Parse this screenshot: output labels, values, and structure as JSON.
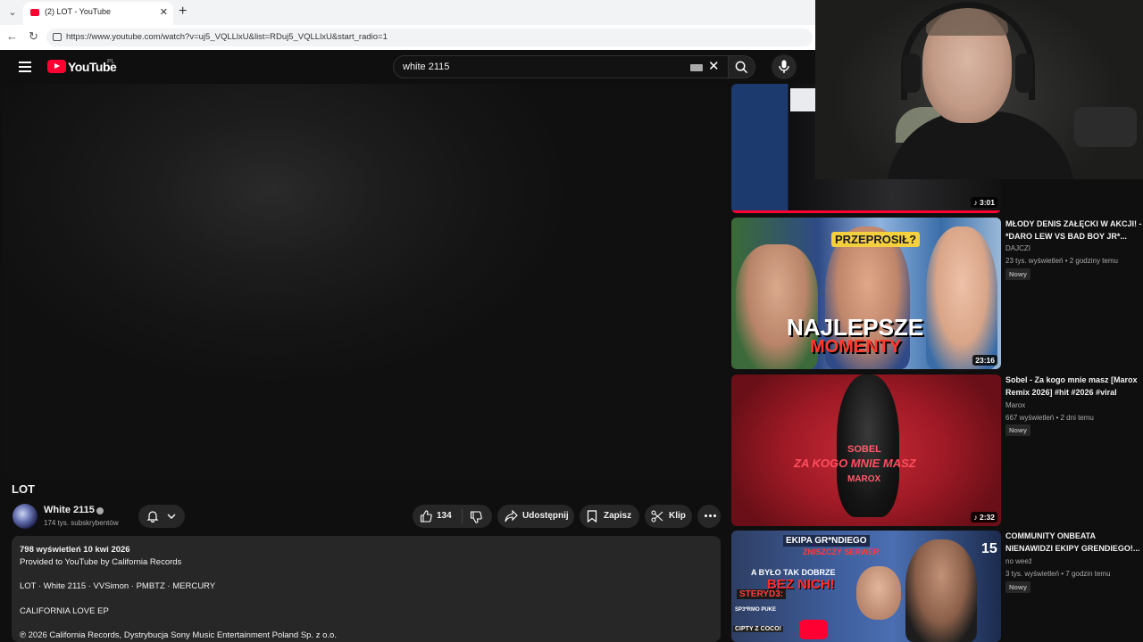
{
  "browser": {
    "tab_title": "(2) LOT - YouTube",
    "url": "https://www.youtube.com/watch?v=uj5_VQLLlxU&list=RDuj5_VQLLlxU&start_radio=1",
    "new_tab_label": "+",
    "close_label": "✕"
  },
  "youtube": {
    "logo_text": "YouTube",
    "country_code": "PL",
    "search_value": "white 2115",
    "clear_label": "✕"
  },
  "video": {
    "title": "LOT",
    "channel": "White 2115",
    "subscribers": "174 tys. subskrybentów",
    "likes": "134",
    "share_label": "Udostępnij",
    "save_label": "Zapisz",
    "clip_label": "Klip",
    "description": {
      "stats": "798 wyświetleń  10 kwi 2026",
      "line1": "Provided to YouTube by California Records",
      "line2": "LOT · White 2115 · VVSimon · PMBTZ · MERCURY",
      "line3": "CALIFORNIA LOVE EP",
      "line4": "℗ 2026 California Records, Dystrybucja Sony Music Entertainment Poland Sp. z o.o."
    }
  },
  "sidebar": {
    "items": [
      {
        "duration": "3:01",
        "watch_progress": 1.0
      },
      {
        "title": "MŁODY DENIS ZAŁĘCKI W AKCJI! - *DARO LEW VS BAD BOY JR*...",
        "channel": "DAJCZI",
        "meta": "23 tys. wyświetleń  •  2 godziny temu",
        "badge": "Nowy",
        "duration": "23:16",
        "thumb_top_text": "PRZEPROSIŁ?",
        "thumb_main_text": "NAJLEPSZE",
        "thumb_sub_text": "MOMENTY"
      },
      {
        "title": "Sobel - Za kogo mnie masz [Marox Remix 2026] #hit #2026 #viral",
        "channel": "Marox",
        "meta": "667 wyświetleń  •  2 dni temu",
        "badge": "Nowy",
        "duration": "2:32",
        "thumb_line1": "SOBEL",
        "thumb_line2": "ZA KOGO MNIE MASZ",
        "thumb_line3": "MAROX"
      },
      {
        "title": "COMMUNITY ONBEATA NIENAWIDZI EKIPY GRENDIEGO!...",
        "channel": "no weeź",
        "meta": "3 tys. wyświetleń  •  7 godzin temu",
        "badge": "Nowy",
        "thumb_line1": "EKIPA GR*NDIEGO",
        "thumb_line2": "ZNISZCZY SERWER",
        "thumb_line3": "A BYŁO TAK DOBRZE",
        "thumb_line4": "BEZ NICH!",
        "thumb_line5": "STERYD3:",
        "thumb_line6": "SP3*RMO PUKE",
        "thumb_line7": "CIPTY Z COCO!",
        "thumb_number": "15"
      }
    ]
  },
  "colors": {
    "brand_red": "#ff0033",
    "background": "#0f0f0f",
    "pill": "#272727"
  }
}
